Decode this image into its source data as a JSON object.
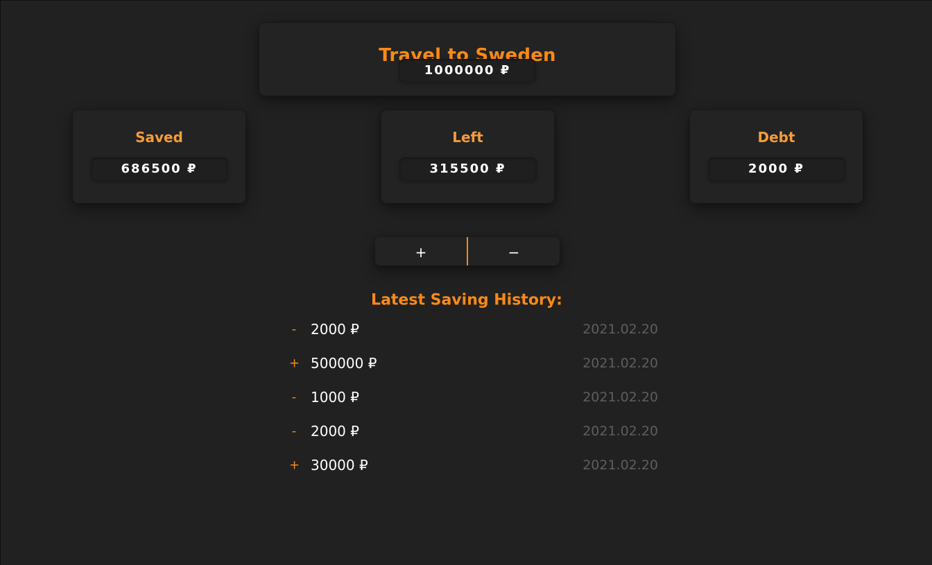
{
  "goal": {
    "title": "Travel to Sweden",
    "amount": "1000000 ₽"
  },
  "stats": {
    "saved": {
      "label": "Saved",
      "value": "686500 ₽"
    },
    "left": {
      "label": "Left",
      "value": "315500 ₽"
    },
    "debt": {
      "label": "Debt",
      "value": "2000 ₽"
    }
  },
  "actions": {
    "add_label": "+",
    "subtract_label": "−"
  },
  "history": {
    "title": "Latest Saving History:",
    "rows": [
      {
        "sign": "-",
        "amount": "2000 ₽",
        "date": "2021.02.20"
      },
      {
        "sign": "+",
        "amount": "500000 ₽",
        "date": "2021.02.20"
      },
      {
        "sign": "-",
        "amount": "1000 ₽",
        "date": "2021.02.20"
      },
      {
        "sign": "-",
        "amount": "2000 ₽",
        "date": "2021.02.20"
      },
      {
        "sign": "+",
        "amount": "30000 ₽",
        "date": "2021.02.20"
      }
    ]
  },
  "colors": {
    "background": "#212121",
    "card": "#232323",
    "accent": "#f98a16",
    "text": "#ffffff",
    "muted": "#5e5e5e"
  }
}
